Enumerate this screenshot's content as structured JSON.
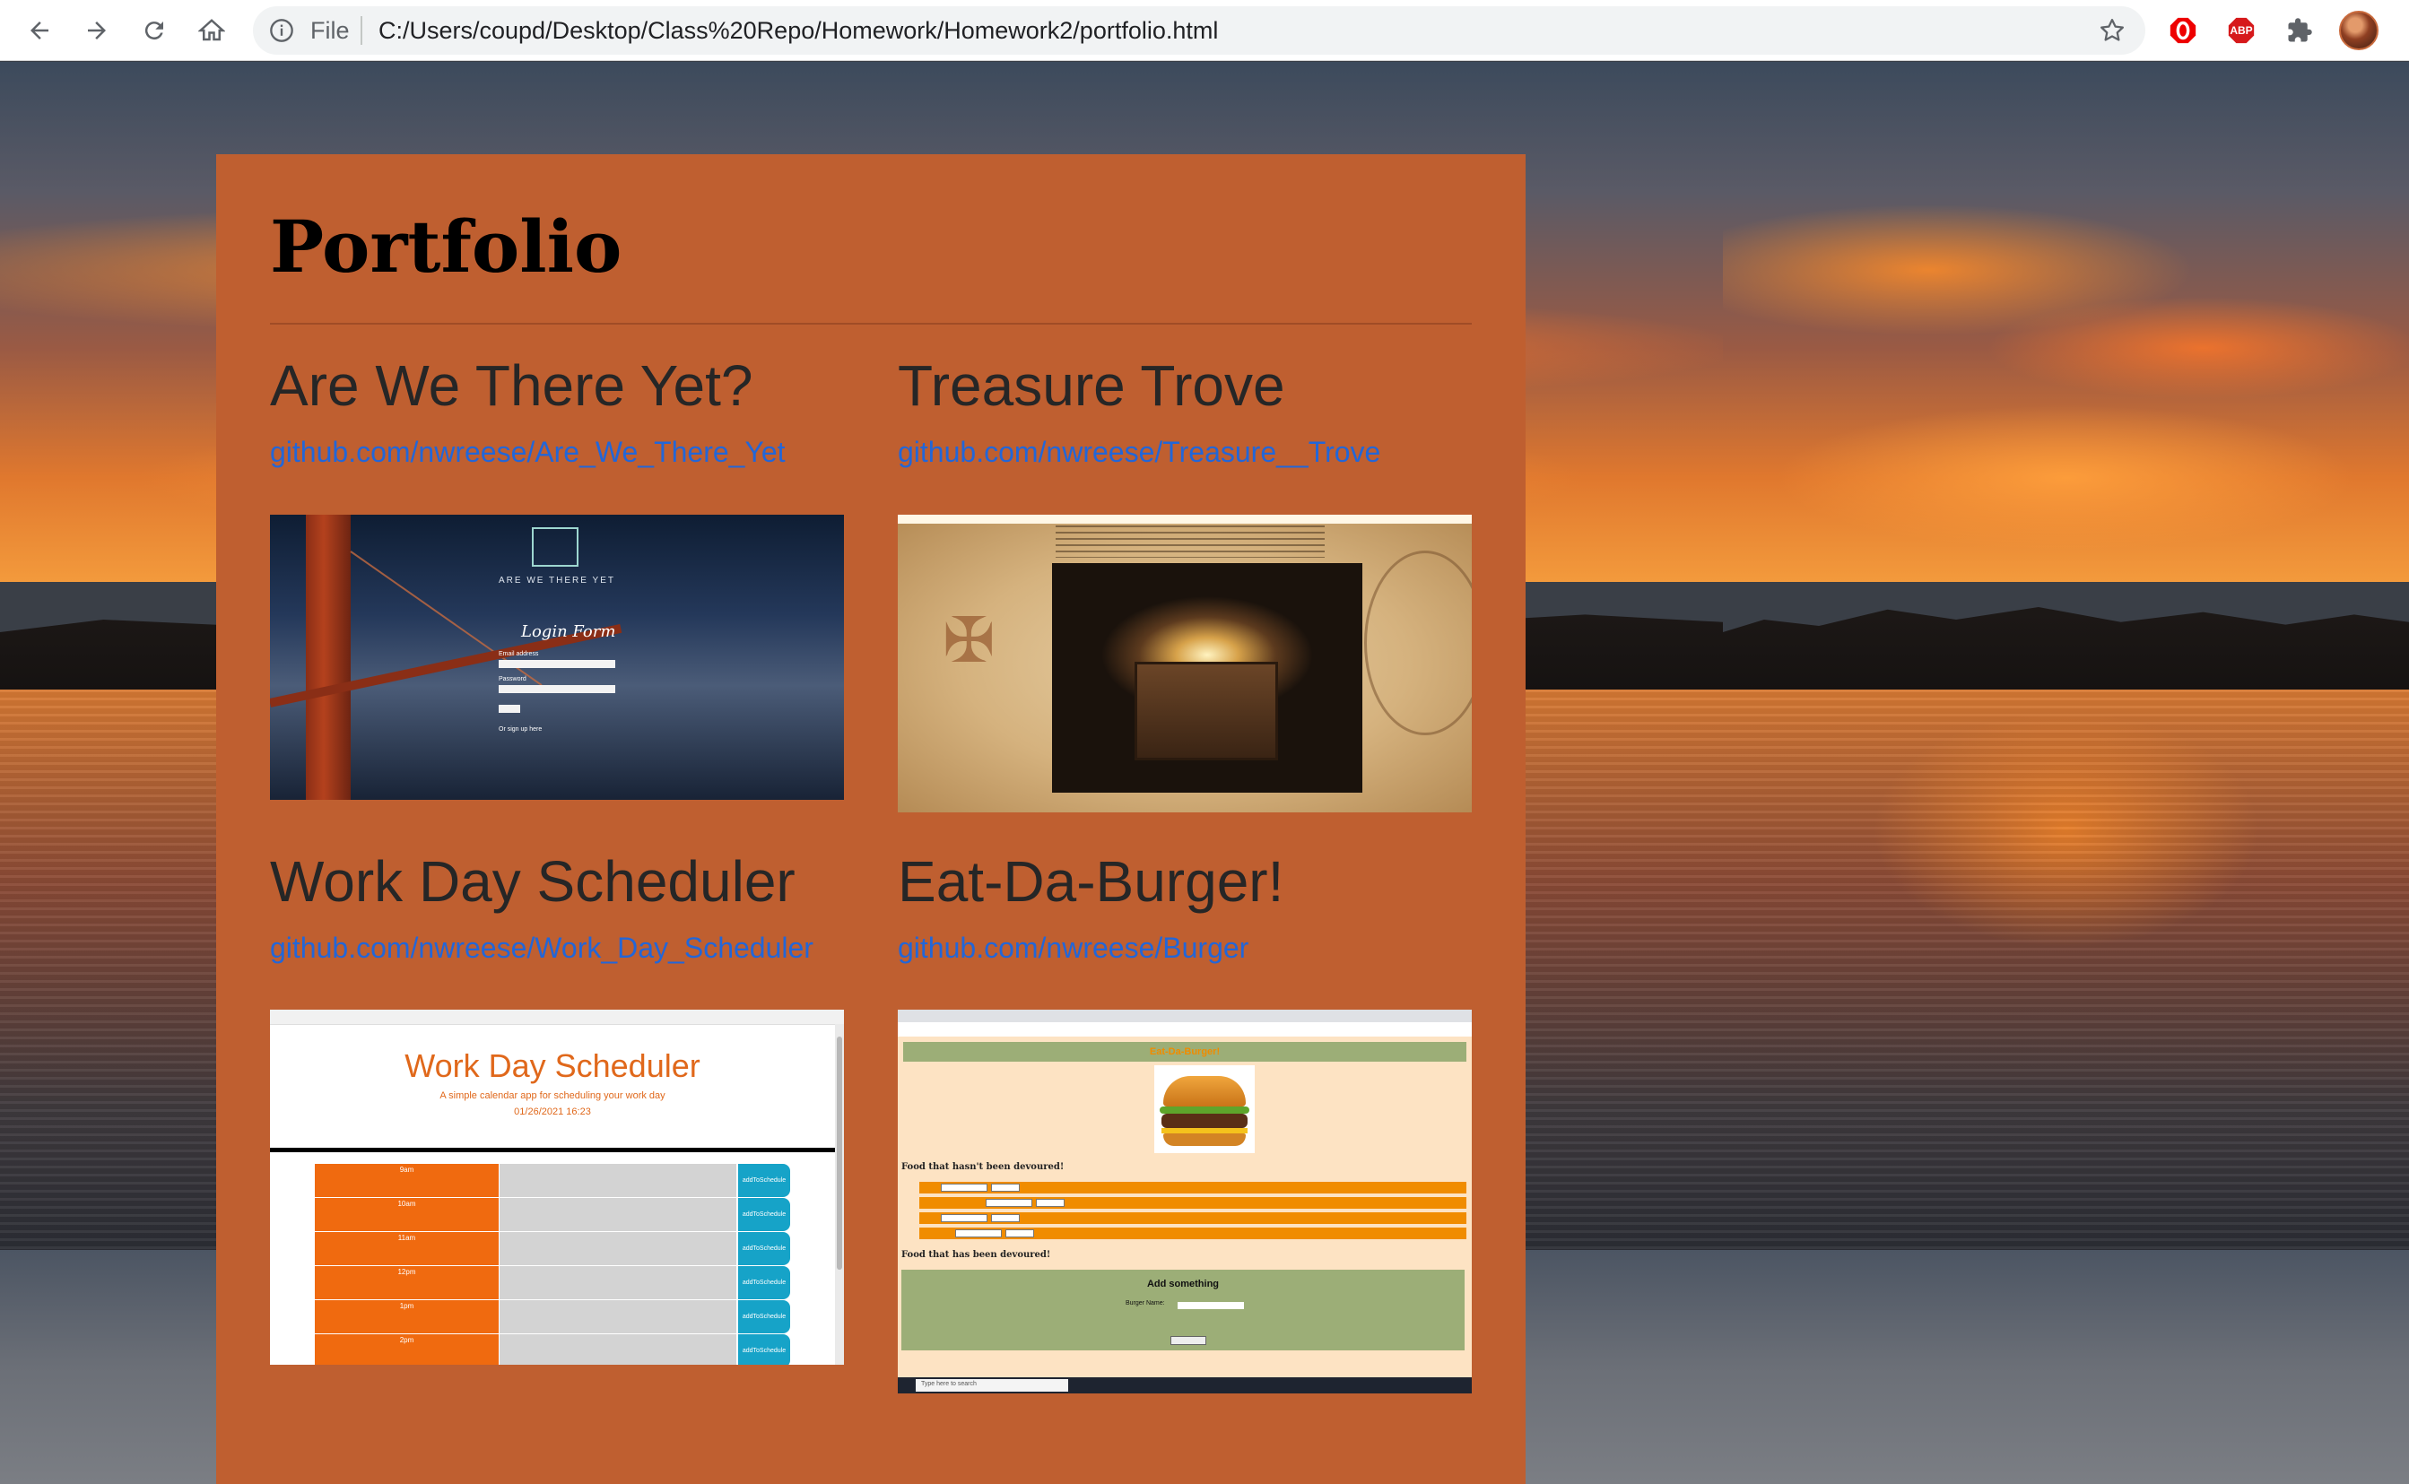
{
  "browser": {
    "scheme_label": "File",
    "url": "C:/Users/coupd/Desktop/Class%20Repo/Homework/Homework2/portfolio.html",
    "extensions": [
      "opera-adblock-icon",
      "abp-icon",
      "puzzle-icon"
    ],
    "abp_label": "ABP"
  },
  "page": {
    "title": "Portfolio",
    "projects": [
      {
        "title": "Are We There Yet?",
        "link": "github.com/nwreese/Are_We_There_Yet",
        "screenshot": {
          "brand": "ARE WE THERE YET",
          "heading": "Login Form",
          "email_label": "Email address",
          "password_label": "Password",
          "signup_text": "Or sign up here"
        }
      },
      {
        "title": "Treasure Trove",
        "link": "github.com/nwreese/Treasure__Trove",
        "screenshot": {
          "heading": "Treasure Trove"
        }
      },
      {
        "title": "Work Day Scheduler",
        "link": "github.com/nwreese/Work_Day_Scheduler",
        "screenshot": {
          "heading": "Work Day Scheduler",
          "subtitle": "A simple calendar app for scheduling your work day",
          "date": "01/26/2021 16:23",
          "hours": [
            "9am",
            "10am",
            "11am",
            "12pm",
            "1pm",
            "2pm"
          ],
          "save_label": "addToSchedule"
        }
      },
      {
        "title": "Eat-Da-Burger!",
        "link": "github.com/nwreese/Burger",
        "screenshot": {
          "heading": "Eat-Da-Burger!",
          "not_devoured_label": "Food that hasn't been devoured!",
          "devoured_label": "Food that has been devoured!",
          "form_title": "Add something",
          "burger_name_label": "Burger Name:",
          "search_placeholder": "Type here to search"
        }
      }
    ]
  },
  "colors": {
    "card": "#bf5f30",
    "link": "#2266d8",
    "scheduler_accent": "#f06a0f",
    "save_button": "#16a3c8"
  }
}
